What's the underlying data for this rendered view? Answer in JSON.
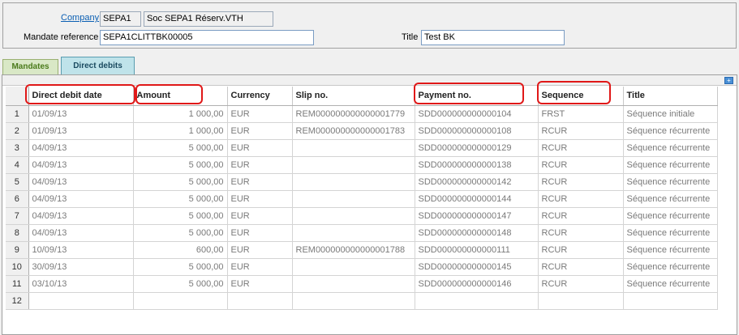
{
  "header": {
    "company_label": "Company",
    "company_code": "SEPA1",
    "company_name": "Soc SEPA1 Réserv.VTH",
    "mandate_label": "Mandate reference",
    "mandate_value": "SEPA1CLITTBK00005",
    "title_label": "Title",
    "title_value": "Test BK"
  },
  "tabs": [
    {
      "label": "Mandates",
      "active": false
    },
    {
      "label": "Direct debits",
      "active": true
    }
  ],
  "grid": {
    "columns": [
      "Direct debit date",
      "Amount",
      "Currency",
      "Slip no.",
      "Payment no.",
      "Sequence",
      "Title"
    ],
    "rows": [
      {
        "n": "1",
        "date": "01/09/13",
        "amount": "1 000,00",
        "currency": "EUR",
        "slip": "REM000000000000001779",
        "payment": "SDD000000000000104",
        "sequence": "FRST",
        "title": "Séquence initiale"
      },
      {
        "n": "2",
        "date": "01/09/13",
        "amount": "1 000,00",
        "currency": "EUR",
        "slip": "REM000000000000001783",
        "payment": "SDD000000000000108",
        "sequence": "RCUR",
        "title": "Séquence récurrente"
      },
      {
        "n": "3",
        "date": "04/09/13",
        "amount": "5 000,00",
        "currency": "EUR",
        "slip": "",
        "payment": "SDD000000000000129",
        "sequence": "RCUR",
        "title": "Séquence récurrente"
      },
      {
        "n": "4",
        "date": "04/09/13",
        "amount": "5 000,00",
        "currency": "EUR",
        "slip": "",
        "payment": "SDD000000000000138",
        "sequence": "RCUR",
        "title": "Séquence récurrente"
      },
      {
        "n": "5",
        "date": "04/09/13",
        "amount": "5 000,00",
        "currency": "EUR",
        "slip": "",
        "payment": "SDD000000000000142",
        "sequence": "RCUR",
        "title": "Séquence récurrente"
      },
      {
        "n": "6",
        "date": "04/09/13",
        "amount": "5 000,00",
        "currency": "EUR",
        "slip": "",
        "payment": "SDD000000000000144",
        "sequence": "RCUR",
        "title": "Séquence récurrente"
      },
      {
        "n": "7",
        "date": "04/09/13",
        "amount": "5 000,00",
        "currency": "EUR",
        "slip": "",
        "payment": "SDD000000000000147",
        "sequence": "RCUR",
        "title": "Séquence récurrente"
      },
      {
        "n": "8",
        "date": "04/09/13",
        "amount": "5 000,00",
        "currency": "EUR",
        "slip": "",
        "payment": "SDD000000000000148",
        "sequence": "RCUR",
        "title": "Séquence récurrente"
      },
      {
        "n": "9",
        "date": "10/09/13",
        "amount": "600,00",
        "currency": "EUR",
        "slip": "REM000000000000001788",
        "payment": "SDD000000000000111",
        "sequence": "RCUR",
        "title": "Séquence récurrente"
      },
      {
        "n": "10",
        "date": "30/09/13",
        "amount": "5 000,00",
        "currency": "EUR",
        "slip": "",
        "payment": "SDD000000000000145",
        "sequence": "RCUR",
        "title": "Séquence récurrente"
      },
      {
        "n": "11",
        "date": "03/10/13",
        "amount": "5 000,00",
        "currency": "EUR",
        "slip": "",
        "payment": "SDD000000000000146",
        "sequence": "RCUR",
        "title": "Séquence récurrente"
      },
      {
        "n": "12",
        "date": "",
        "amount": "",
        "currency": "",
        "slip": "",
        "payment": "",
        "sequence": "",
        "title": ""
      }
    ]
  },
  "colors": {
    "highlight": "#e01818",
    "link": "#0b5fb3"
  },
  "icons": {
    "panel_corner": "expand-icon"
  }
}
